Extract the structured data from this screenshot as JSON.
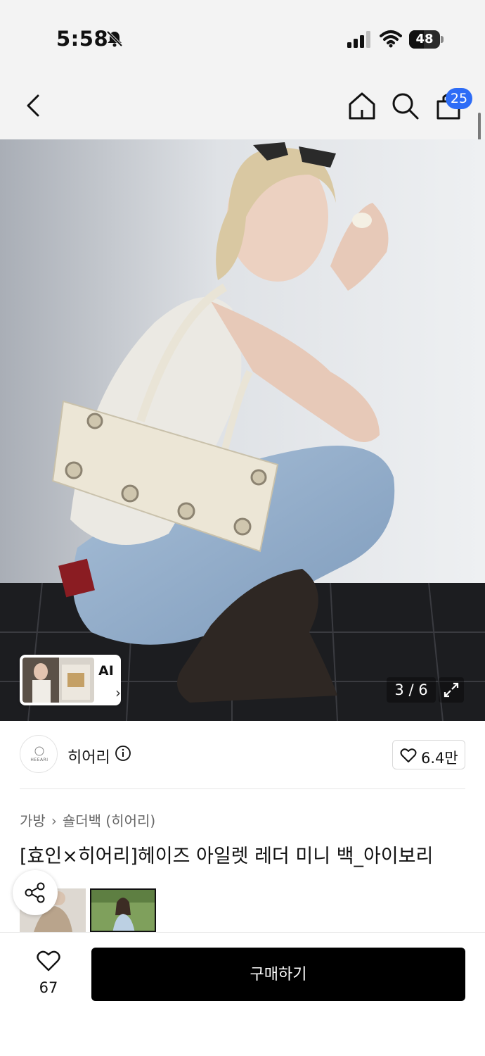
{
  "status": {
    "time": "5:58",
    "battery": "48",
    "battery_level": 0.48,
    "icons": [
      "bell-slash-icon",
      "signal-icon",
      "wifi-icon",
      "battery-icon"
    ]
  },
  "nav": {
    "icons": [
      "back-arrow-icon",
      "home-icon",
      "search-icon",
      "cart-icon"
    ],
    "cart_count": "25"
  },
  "gallery": {
    "ai_label": "AI",
    "counter": "3 / 6",
    "icons": [
      "expand-icon"
    ]
  },
  "brand": {
    "name": "히어리",
    "logo_text": "HEEARI",
    "like_count": "6.4만",
    "icons": [
      "info-icon",
      "heart-outline-icon"
    ]
  },
  "breadcrumb": {
    "items": [
      "가방",
      "숄더백 (히어리)"
    ]
  },
  "product": {
    "title": "[효인×히어리]헤이즈 아일렛 레더 미니 백_아이보리"
  },
  "share": {
    "icon": "share-icon"
  },
  "bottom": {
    "wish_count": "67",
    "buy_label": "구매하기"
  },
  "colors": {
    "accent_badge": "#2d6cf6",
    "buy_button": "#000000",
    "header_bg": "#f3f3f3"
  }
}
